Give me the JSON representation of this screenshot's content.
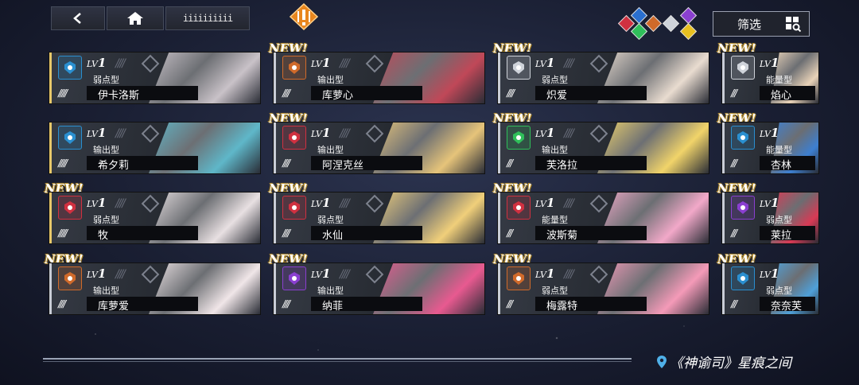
{
  "topbar": {
    "list_label": "iiiiiiiiii"
  },
  "filter": {
    "label": "筛选"
  },
  "location": {
    "text": "《神谕司》星痕之间"
  },
  "new_label": "NEW!",
  "lv_prefix": "LV",
  "lv_value": "1",
  "cards": [
    {
      "name": "伊卡洛斯",
      "type": "弱点型",
      "stars": "/////",
      "new": false,
      "badge_color": "#2a8fd0",
      "badge_icon": "shield-icon"
    },
    {
      "name": "库萝心",
      "type": "输出型",
      "stars": "////",
      "new": true,
      "badge_color": "#d06a2a",
      "badge_icon": "ram-icon"
    },
    {
      "name": "炽爱",
      "type": "弱点型",
      "stars": "////",
      "new": true,
      "badge_color": "#cfd3da",
      "badge_icon": "wings-icon"
    },
    {
      "name": "焰心",
      "type": "能量型",
      "stars": "///",
      "new": true,
      "badge_color": "#cfd3da",
      "badge_icon": "wings-icon"
    },
    {
      "name": "希夕莉",
      "type": "输出型",
      "stars": "/////",
      "new": false,
      "badge_color": "#2a8fd0",
      "badge_icon": "shield-icon"
    },
    {
      "name": "阿涅克丝",
      "type": "输出型",
      "stars": "////",
      "new": true,
      "badge_color": "#d03040",
      "badge_icon": "wolf-icon"
    },
    {
      "name": "芙洛拉",
      "type": "输出型",
      "stars": "///",
      "new": true,
      "badge_color": "#2fbf5a",
      "badge_icon": "tree-icon"
    },
    {
      "name": "杏林",
      "type": "能量型",
      "stars": "///",
      "new": true,
      "badge_color": "#2a8fd0",
      "badge_icon": "shield-icon"
    },
    {
      "name": "牧",
      "type": "弱点型",
      "stars": "/////",
      "new": true,
      "badge_color": "#d03040",
      "badge_icon": "wolf-icon"
    },
    {
      "name": "水仙",
      "type": "弱点型",
      "stars": "////",
      "new": true,
      "badge_color": "#d03040",
      "badge_icon": "wolf-icon"
    },
    {
      "name": "波斯菊",
      "type": "能量型",
      "stars": "///",
      "new": true,
      "badge_color": "#d03040",
      "badge_icon": "wolf-icon"
    },
    {
      "name": "莱拉",
      "type": "弱点型",
      "stars": "///",
      "new": true,
      "badge_color": "#8a3fd0",
      "badge_icon": "crown-icon"
    },
    {
      "name": "库萝爱",
      "type": "输出型",
      "stars": "////",
      "new": true,
      "badge_color": "#d06a2a",
      "badge_icon": "ram-icon"
    },
    {
      "name": "纳菲",
      "type": "输出型",
      "stars": "////",
      "new": true,
      "badge_color": "#8a3fd0",
      "badge_icon": "crown-icon"
    },
    {
      "name": "梅露特",
      "type": "弱点型",
      "stars": "///",
      "new": true,
      "badge_color": "#d06a2a",
      "badge_icon": "ram-icon"
    },
    {
      "name": "奈奈芙",
      "type": "弱点型",
      "stars": "///",
      "new": true,
      "badge_color": "#2a8fd0",
      "badge_icon": "shield-icon"
    }
  ],
  "colors": {
    "portraits": [
      "#c9c2c8",
      "#c04858",
      "#e9dcd0",
      "#e8d2b8",
      "#5fb7c9",
      "#e6c47a",
      "#f1d46a",
      "#3d7fd0",
      "#e8e0e2",
      "#f0cf7a",
      "#f2a9c9",
      "#d83a55",
      "#f0e6e8",
      "#e85a90",
      "#f49ab8",
      "#4fa0d8"
    ]
  }
}
